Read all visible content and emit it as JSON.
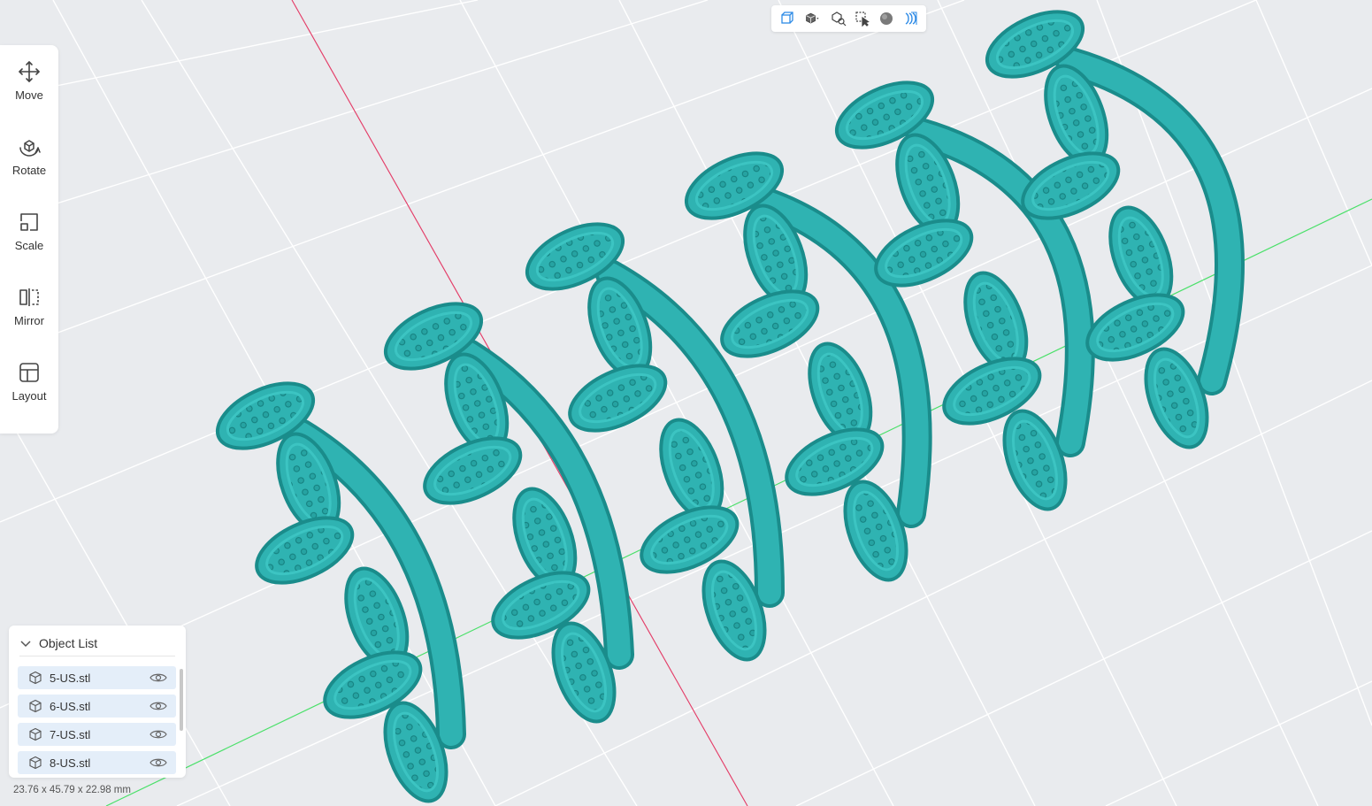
{
  "toolbar": {
    "items": [
      {
        "label": "Move",
        "icon": "move-icon"
      },
      {
        "label": "Rotate",
        "icon": "rotate-icon"
      },
      {
        "label": "Scale",
        "icon": "scale-icon"
      },
      {
        "label": "Mirror",
        "icon": "mirror-icon"
      },
      {
        "label": "Layout",
        "icon": "layout-icon"
      }
    ]
  },
  "view_toolbar": {
    "icons": [
      "perspective-view-icon",
      "view-cube-dropdown-icon",
      "view-zoom-icon",
      "select-model-icon",
      "shading-sphere-icon",
      "layer-view-icon"
    ]
  },
  "object_list": {
    "title": "Object List",
    "items": [
      {
        "name": "5-US.stl"
      },
      {
        "name": "6-US.stl"
      },
      {
        "name": "7-US.stl"
      },
      {
        "name": "8-US.stl"
      }
    ]
  },
  "status": {
    "dimensions": "23.76 x 45.79 x 22.98 mm"
  },
  "colors": {
    "model": "#2fb3b2",
    "model_shadow": "#1a8c8b",
    "background": "#e9ebee",
    "grid_line": "#ffffff",
    "x_axis": "#e0406a",
    "y_axis": "#4be06a",
    "accent": "#2e8be6"
  }
}
